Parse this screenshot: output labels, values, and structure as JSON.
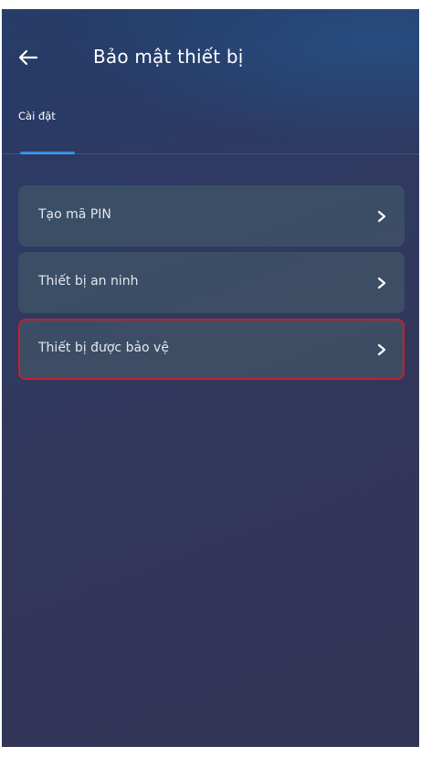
{
  "header": {
    "title": "Bảo mật thiết bị",
    "back_icon": "arrow-left-icon"
  },
  "tabs": [
    {
      "label": "Cài đặt",
      "selected": true
    }
  ],
  "menu": {
    "items": [
      {
        "label": "Tạo mã PIN",
        "icon": "chevron-right-icon"
      },
      {
        "label": "Thiết bị an ninh",
        "icon": "chevron-right-icon"
      },
      {
        "label": "Thiết bị được bảo vệ",
        "icon": "chevron-right-icon",
        "highlighted": true
      }
    ]
  },
  "colors": {
    "background_top": "#2b3f6b",
    "background_bottom": "#333556",
    "tab_indicator": "#2f8fe0",
    "menu_item_bg": "#3f5560",
    "highlight_border": "#c5202c",
    "text": "#ffffff"
  }
}
